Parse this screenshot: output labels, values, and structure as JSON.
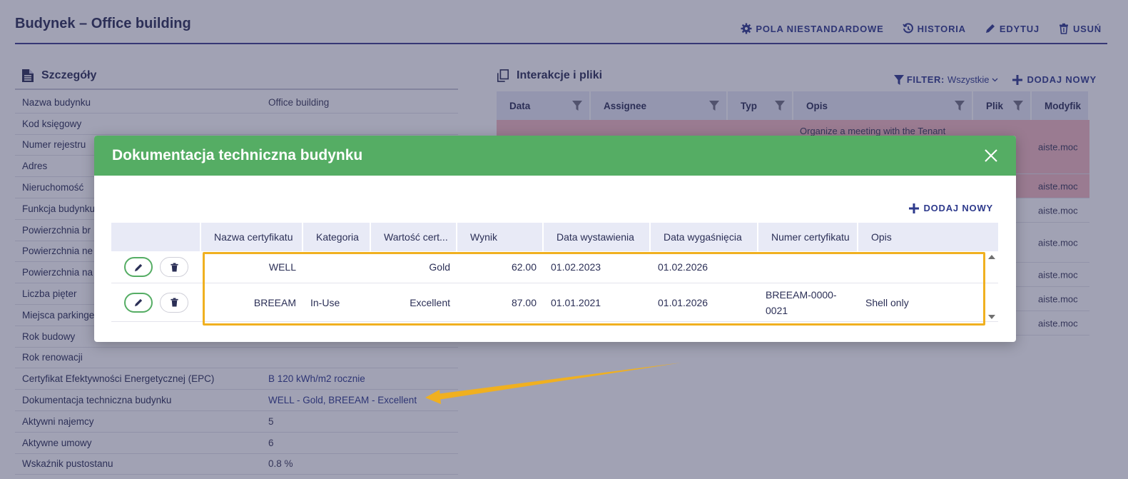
{
  "page": {
    "title": "Budynek – Office building",
    "actions": {
      "custom_fields": "POLA NIESTANDARDOWE",
      "history": "HISTORIA",
      "edit": "EDYTUJ",
      "delete": "USUŃ"
    }
  },
  "details": {
    "title": "Szczegóły",
    "rows": [
      {
        "label": "Nazwa budynku",
        "value": "Office building"
      },
      {
        "label": "Kod księgowy",
        "value": ""
      },
      {
        "label": "Numer rejestru",
        "value": ""
      },
      {
        "label": "Adres",
        "value": ""
      },
      {
        "label": "Nieruchomość",
        "value": ""
      },
      {
        "label": "Funkcja budynku",
        "value": ""
      },
      {
        "label": "Powierzchnia br",
        "value": ""
      },
      {
        "label": "Powierzchnia ne",
        "value": ""
      },
      {
        "label": "Powierzchnia na",
        "value": ""
      },
      {
        "label": "Liczba pięter",
        "value": ""
      },
      {
        "label": "Miejsca parkinge",
        "value": ""
      },
      {
        "label": "Rok budowy",
        "value": ""
      },
      {
        "label": "Rok renowacji",
        "value": ""
      },
      {
        "label": "Certyfikat Efektywności Energetycznej (EPC)",
        "value": "B 120 kWh/m2 rocznie"
      },
      {
        "label": "Dokumentacja techniczna budynku",
        "value": "WELL - Gold, BREEAM - Excellent"
      },
      {
        "label": "Aktywni najemcy",
        "value": "5"
      },
      {
        "label": "Aktywne umowy",
        "value": "6"
      },
      {
        "label": "Wskaźnik pustostanu",
        "value": "0.8 %"
      }
    ]
  },
  "interactions": {
    "title": "Interakcje i pliki",
    "filter_label": "FILTER:",
    "filter_value": "Wszystkie",
    "add_label": "DODAJ NOWY",
    "columns": [
      "Data",
      "Assignee",
      "Typ",
      "Opis",
      "Plik",
      "Modyfik"
    ],
    "rows": [
      {
        "desc": "Organize a meeting with the Tenant",
        "mod": "aiste.moc"
      },
      {
        "desc": "",
        "mod": "aiste.moc"
      },
      {
        "desc": "",
        "mod": "aiste.moc"
      },
      {
        "desc": "",
        "mod": "aiste.moc"
      },
      {
        "desc": "",
        "mod": "aiste.moc"
      },
      {
        "desc": "",
        "mod": "aiste.moc"
      },
      {
        "desc": "",
        "mod": "aiste.moc"
      }
    ]
  },
  "modal": {
    "title": "Dokumentacja techniczna budynku",
    "add_label": "DODAJ NOWY",
    "columns": [
      "Nazwa certyfikatu",
      "Kategoria",
      "Wartość cert...",
      "Wynik",
      "Data wystawienia",
      "Data wygaśnięcia",
      "Numer certyfikatu",
      "Opis"
    ],
    "rows": [
      {
        "name": "WELL",
        "category": "",
        "value": "Gold",
        "score": "62.00",
        "issued": "01.02.2023",
        "expires": "01.02.2026",
        "number": "",
        "desc": ""
      },
      {
        "name": "BREEAM",
        "category": "In-Use",
        "value": "Excellent",
        "score": "87.00",
        "issued": "01.01.2021",
        "expires": "01.01.2026",
        "number": "BREEAM-0000-0021",
        "desc": "Shell only"
      }
    ]
  },
  "colors": {
    "modal_header": "#55ad64",
    "accent": "#2e3a8c",
    "highlight": "#f0b020",
    "row_alert": "#f3b9bf"
  }
}
